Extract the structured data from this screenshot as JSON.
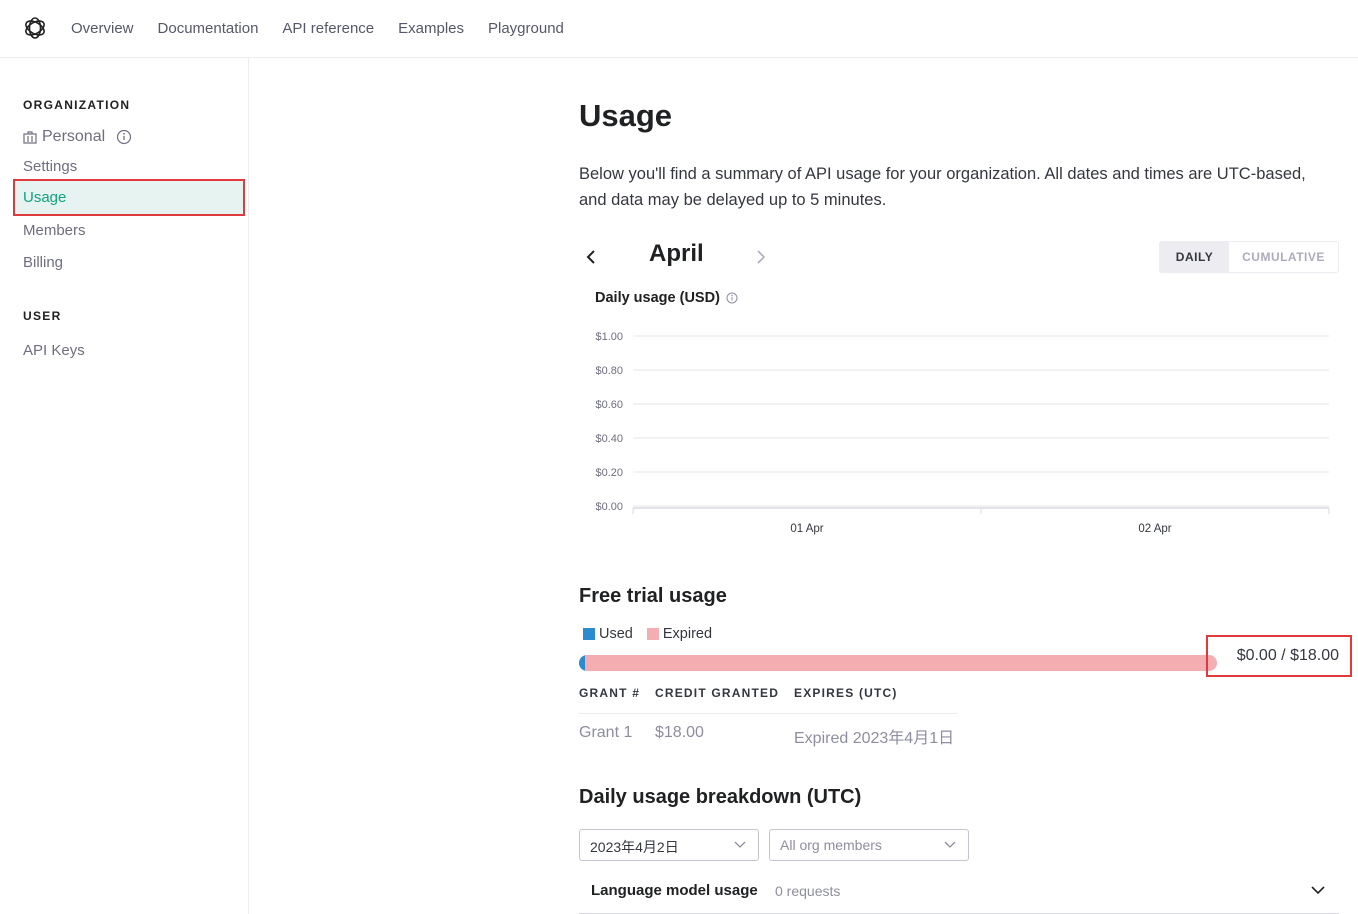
{
  "nav": {
    "links": [
      "Overview",
      "Documentation",
      "API reference",
      "Examples",
      "Playground"
    ]
  },
  "sidebar": {
    "org_heading": "ORGANIZATION",
    "org_name": "Personal",
    "items": [
      "Settings",
      "Usage",
      "Members",
      "Billing"
    ],
    "user_heading": "USER",
    "user_items": [
      "API Keys"
    ]
  },
  "page": {
    "title": "Usage",
    "intro": "Below you'll find a summary of API usage for your organization. All dates and times are UTC-based, and data may be delayed up to 5 minutes.",
    "month": "April",
    "toggle": {
      "daily": "DAILY",
      "cumulative": "CUMULATIVE",
      "selected": "DAILY"
    }
  },
  "chart_data": {
    "type": "bar",
    "title": "Daily usage (USD)",
    "categories": [
      "01 Apr",
      "02 Apr"
    ],
    "values": [
      0,
      0
    ],
    "y_ticks": [
      "$1.00",
      "$0.80",
      "$0.60",
      "$0.40",
      "$0.20",
      "$0.00"
    ],
    "ylim": [
      0,
      1
    ],
    "grid": true
  },
  "free_trial": {
    "title": "Free trial usage",
    "legend": [
      {
        "label": "Used",
        "color": "#2b8bd1"
      },
      {
        "label": "Expired",
        "color": "#f4aeb1"
      }
    ],
    "used": 0,
    "total": 18,
    "amount_text": "$0.00 / $18.00",
    "table": {
      "headers": [
        "GRANT #",
        "CREDIT GRANTED",
        "EXPIRES (UTC)"
      ],
      "rows": [
        [
          "Grant 1",
          "$18.00",
          "Expired 2023年4月1日"
        ]
      ]
    }
  },
  "breakdown": {
    "title": "Daily usage breakdown (UTC)",
    "date_select": "2023年4月2日",
    "members_select": "All org members",
    "language_model": {
      "title": "Language model usage",
      "count": "0 requests"
    }
  },
  "colors": {
    "accent": "#10a37f",
    "highlight": "#e0393e"
  }
}
